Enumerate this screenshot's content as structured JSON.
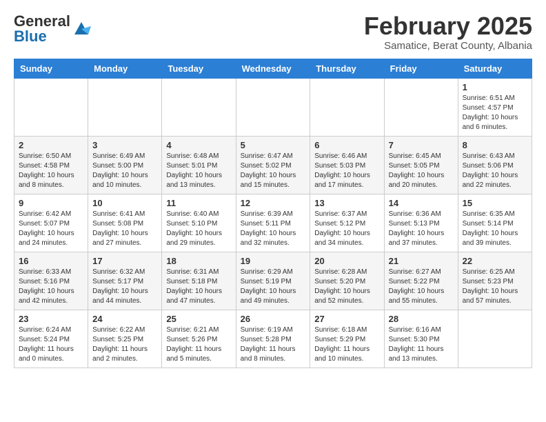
{
  "header": {
    "logo_general": "General",
    "logo_blue": "Blue",
    "month_title": "February 2025",
    "location": "Samatice, Berat County, Albania"
  },
  "days_of_week": [
    "Sunday",
    "Monday",
    "Tuesday",
    "Wednesday",
    "Thursday",
    "Friday",
    "Saturday"
  ],
  "weeks": [
    [
      {
        "day": "",
        "info": ""
      },
      {
        "day": "",
        "info": ""
      },
      {
        "day": "",
        "info": ""
      },
      {
        "day": "",
        "info": ""
      },
      {
        "day": "",
        "info": ""
      },
      {
        "day": "",
        "info": ""
      },
      {
        "day": "1",
        "info": "Sunrise: 6:51 AM\nSunset: 4:57 PM\nDaylight: 10 hours\nand 6 minutes."
      }
    ],
    [
      {
        "day": "2",
        "info": "Sunrise: 6:50 AM\nSunset: 4:58 PM\nDaylight: 10 hours\nand 8 minutes."
      },
      {
        "day": "3",
        "info": "Sunrise: 6:49 AM\nSunset: 5:00 PM\nDaylight: 10 hours\nand 10 minutes."
      },
      {
        "day": "4",
        "info": "Sunrise: 6:48 AM\nSunset: 5:01 PM\nDaylight: 10 hours\nand 13 minutes."
      },
      {
        "day": "5",
        "info": "Sunrise: 6:47 AM\nSunset: 5:02 PM\nDaylight: 10 hours\nand 15 minutes."
      },
      {
        "day": "6",
        "info": "Sunrise: 6:46 AM\nSunset: 5:03 PM\nDaylight: 10 hours\nand 17 minutes."
      },
      {
        "day": "7",
        "info": "Sunrise: 6:45 AM\nSunset: 5:05 PM\nDaylight: 10 hours\nand 20 minutes."
      },
      {
        "day": "8",
        "info": "Sunrise: 6:43 AM\nSunset: 5:06 PM\nDaylight: 10 hours\nand 22 minutes."
      }
    ],
    [
      {
        "day": "9",
        "info": "Sunrise: 6:42 AM\nSunset: 5:07 PM\nDaylight: 10 hours\nand 24 minutes."
      },
      {
        "day": "10",
        "info": "Sunrise: 6:41 AM\nSunset: 5:08 PM\nDaylight: 10 hours\nand 27 minutes."
      },
      {
        "day": "11",
        "info": "Sunrise: 6:40 AM\nSunset: 5:10 PM\nDaylight: 10 hours\nand 29 minutes."
      },
      {
        "day": "12",
        "info": "Sunrise: 6:39 AM\nSunset: 5:11 PM\nDaylight: 10 hours\nand 32 minutes."
      },
      {
        "day": "13",
        "info": "Sunrise: 6:37 AM\nSunset: 5:12 PM\nDaylight: 10 hours\nand 34 minutes."
      },
      {
        "day": "14",
        "info": "Sunrise: 6:36 AM\nSunset: 5:13 PM\nDaylight: 10 hours\nand 37 minutes."
      },
      {
        "day": "15",
        "info": "Sunrise: 6:35 AM\nSunset: 5:14 PM\nDaylight: 10 hours\nand 39 minutes."
      }
    ],
    [
      {
        "day": "16",
        "info": "Sunrise: 6:33 AM\nSunset: 5:16 PM\nDaylight: 10 hours\nand 42 minutes."
      },
      {
        "day": "17",
        "info": "Sunrise: 6:32 AM\nSunset: 5:17 PM\nDaylight: 10 hours\nand 44 minutes."
      },
      {
        "day": "18",
        "info": "Sunrise: 6:31 AM\nSunset: 5:18 PM\nDaylight: 10 hours\nand 47 minutes."
      },
      {
        "day": "19",
        "info": "Sunrise: 6:29 AM\nSunset: 5:19 PM\nDaylight: 10 hours\nand 49 minutes."
      },
      {
        "day": "20",
        "info": "Sunrise: 6:28 AM\nSunset: 5:20 PM\nDaylight: 10 hours\nand 52 minutes."
      },
      {
        "day": "21",
        "info": "Sunrise: 6:27 AM\nSunset: 5:22 PM\nDaylight: 10 hours\nand 55 minutes."
      },
      {
        "day": "22",
        "info": "Sunrise: 6:25 AM\nSunset: 5:23 PM\nDaylight: 10 hours\nand 57 minutes."
      }
    ],
    [
      {
        "day": "23",
        "info": "Sunrise: 6:24 AM\nSunset: 5:24 PM\nDaylight: 11 hours\nand 0 minutes."
      },
      {
        "day": "24",
        "info": "Sunrise: 6:22 AM\nSunset: 5:25 PM\nDaylight: 11 hours\nand 2 minutes."
      },
      {
        "day": "25",
        "info": "Sunrise: 6:21 AM\nSunset: 5:26 PM\nDaylight: 11 hours\nand 5 minutes."
      },
      {
        "day": "26",
        "info": "Sunrise: 6:19 AM\nSunset: 5:28 PM\nDaylight: 11 hours\nand 8 minutes."
      },
      {
        "day": "27",
        "info": "Sunrise: 6:18 AM\nSunset: 5:29 PM\nDaylight: 11 hours\nand 10 minutes."
      },
      {
        "day": "28",
        "info": "Sunrise: 6:16 AM\nSunset: 5:30 PM\nDaylight: 11 hours\nand 13 minutes."
      },
      {
        "day": "",
        "info": ""
      }
    ]
  ]
}
